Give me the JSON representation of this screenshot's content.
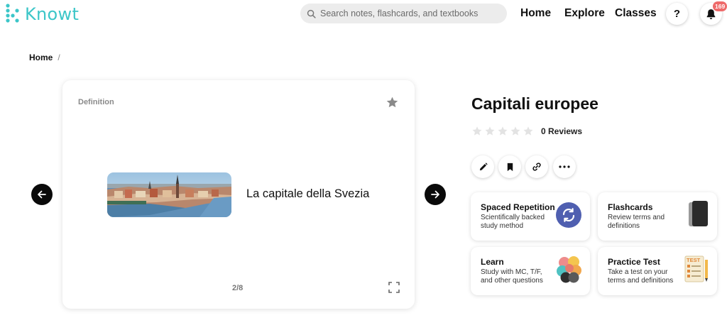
{
  "header": {
    "logo_text": "Knowt",
    "search_placeholder": "Search notes, flashcards, and textbooks",
    "nav": [
      "Home",
      "Explore",
      "Classes"
    ],
    "help_label": "?",
    "notification_count": "169"
  },
  "breadcrumb": {
    "home": "Home",
    "separator": "/"
  },
  "flashcard": {
    "side_label": "Definition",
    "text": "La capitale della Svezia",
    "counter": "2/8"
  },
  "set": {
    "title": "Capitali europee",
    "rating_stars": 0,
    "reviews_label": "0 Reviews"
  },
  "study_modes": [
    {
      "title": "Spaced Repetition",
      "description": "Scientifically backed study method"
    },
    {
      "title": "Flashcards",
      "description": "Review terms and definitions"
    },
    {
      "title": "Learn",
      "description": "Study with MC, T/F, and other questions"
    },
    {
      "title": "Practice Test",
      "description": "Take a test on your terms and definitions"
    }
  ],
  "colors": {
    "brand": "#3cc6c8",
    "badge": "#ee6a6a",
    "spaced_repetition_icon": "#4f5fb0"
  }
}
